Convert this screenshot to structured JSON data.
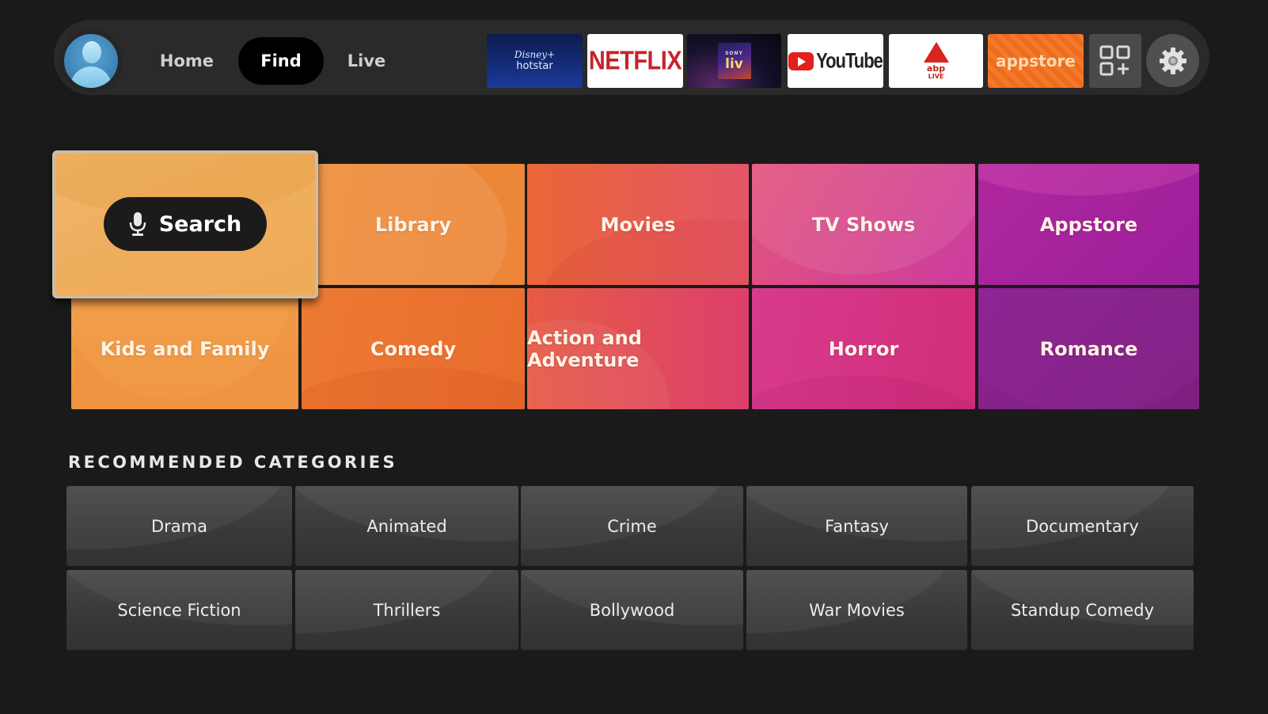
{
  "topbar": {
    "profile_icon": "profile-avatar-icon",
    "nav": [
      {
        "label": "Home",
        "active": false
      },
      {
        "label": "Find",
        "active": true
      },
      {
        "label": "Live",
        "active": false
      }
    ],
    "apps": [
      {
        "name": "Disney+ Hotstar",
        "line1": "Disney+",
        "line2": "hotstar"
      },
      {
        "name": "Netflix",
        "label": "NETFLIX"
      },
      {
        "name": "Sony LIV",
        "line1": "SONY",
        "line2": "liv"
      },
      {
        "name": "YouTube",
        "label": "YouTube"
      },
      {
        "name": "ABP Live",
        "line1": "abp",
        "line2": "LIVE"
      },
      {
        "name": "Appstore",
        "label": "appstore"
      }
    ],
    "app_library_icon": "app-library-icon",
    "settings_icon": "gear-icon"
  },
  "main": {
    "search_label": "Search",
    "categories": [
      "Library",
      "Movies",
      "TV Shows",
      "Appstore",
      "Kids and Family",
      "Comedy",
      "Action and Adventure",
      "Horror",
      "Romance"
    ]
  },
  "recommended": {
    "heading": "RECOMMENDED CATEGORIES",
    "items": [
      "Drama",
      "Animated",
      "Crime",
      "Fantasy",
      "Documentary",
      "Science Fiction",
      "Thrillers",
      "Bollywood",
      "War Movies",
      "Standup Comedy"
    ]
  },
  "colors": {
    "background": "#1a1a1a",
    "topbar": "#2a2a2a",
    "active_nav": "#000000",
    "search_tile": "#efae5e",
    "netflix_red": "#c8232b",
    "youtube_red": "#e3201b",
    "appstore_orange": "#ef6c1e"
  }
}
